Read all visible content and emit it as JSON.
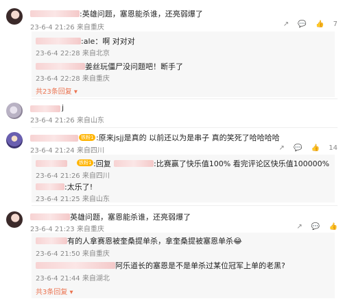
{
  "comments": [
    {
      "text": ":英雄问题，塞恩能杀谁，还亮弱爆了",
      "time": "23-6-4 21:26",
      "loc": "来自重庆",
      "likes": "7",
      "replies": [
        {
          "text": ":ale：啊 对对对",
          "time": "23-6-4 22:28",
          "loc": "来自北京"
        },
        {
          "text": "姜丝玩僵尸没问题吧！断手了",
          "time": "23-6-4 22:28",
          "loc": "来自重庆"
        }
      ],
      "more": "共23条回复"
    },
    {
      "text": "j",
      "time": "23-6-4 21:26",
      "loc": "来自山东"
    },
    {
      "text": ":原来jsjj是真的 以前还以为是串子 真的笑死了哈哈哈哈",
      "time": "23-6-4 21:24",
      "loc": "来自四川",
      "likes": "14",
      "replies": [
        {
          "text": ":回复",
          "text2": ":比赛赢了快乐值100% 看完评论区快乐值100000%",
          "time": "23-6-4 21:26",
          "loc": "来自四川"
        },
        {
          "text": ":太乐了!",
          "time": "23-6-4 21:25",
          "loc": "来自山东"
        }
      ]
    },
    {
      "text": "英雄问题，塞恩能杀谁，还亮弱爆了",
      "time": "23-6-4 21:23",
      "loc": "来自重庆",
      "replies": [
        {
          "text": "有的人拿赛恩被奎桑提单杀，拿奎桑提被塞恩单杀😂",
          "time": "23-6-4 21:50",
          "loc": "来自重庆"
        },
        {
          "text": "阿乐道长的塞恩是不是单杀过某位冠军上单的老黑?",
          "time": "23-6-4 21:44",
          "loc": "来自湖北"
        }
      ],
      "more": "共3条回复"
    }
  ],
  "badge": "铁粉1",
  "icons": [
    "share-icon",
    "comment-icon",
    "like-icon"
  ]
}
